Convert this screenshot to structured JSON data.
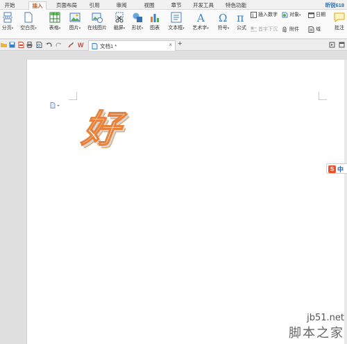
{
  "tabs": [
    "开始",
    "插入",
    "页面布局",
    "引用",
    "审阅",
    "视图",
    "章节",
    "开发工具",
    "特色功能"
  ],
  "active_tab_index": 1,
  "user": "昕锐618",
  "ribbon": {
    "page_break": "分页",
    "blank_page": "空白页",
    "table": "表格",
    "picture": "图片",
    "online_picture": "在线图片",
    "screenshot": "截屏",
    "shape": "形状",
    "chart": "图表",
    "textbox": "文本框",
    "wordart": "艺术字",
    "symbol": "符号",
    "formula": "公式",
    "insert_number": "插入数字",
    "drop_cap": "首字下沉",
    "object": "对象",
    "attachment": "附件",
    "date": "日期",
    "field": "域",
    "comment": "批注"
  },
  "document": {
    "tab_title": "文档1 *",
    "close": "×",
    "new_tab": "+",
    "wordart_text": "好"
  },
  "ime": {
    "label": "中",
    "logo": "S"
  },
  "watermark": {
    "line1": "jb51.net",
    "line2": "脚本之家"
  },
  "colors": {
    "accent": "#c35a1b",
    "wordart_outline": "#e8823a",
    "ime_logo": "#e8532b"
  }
}
